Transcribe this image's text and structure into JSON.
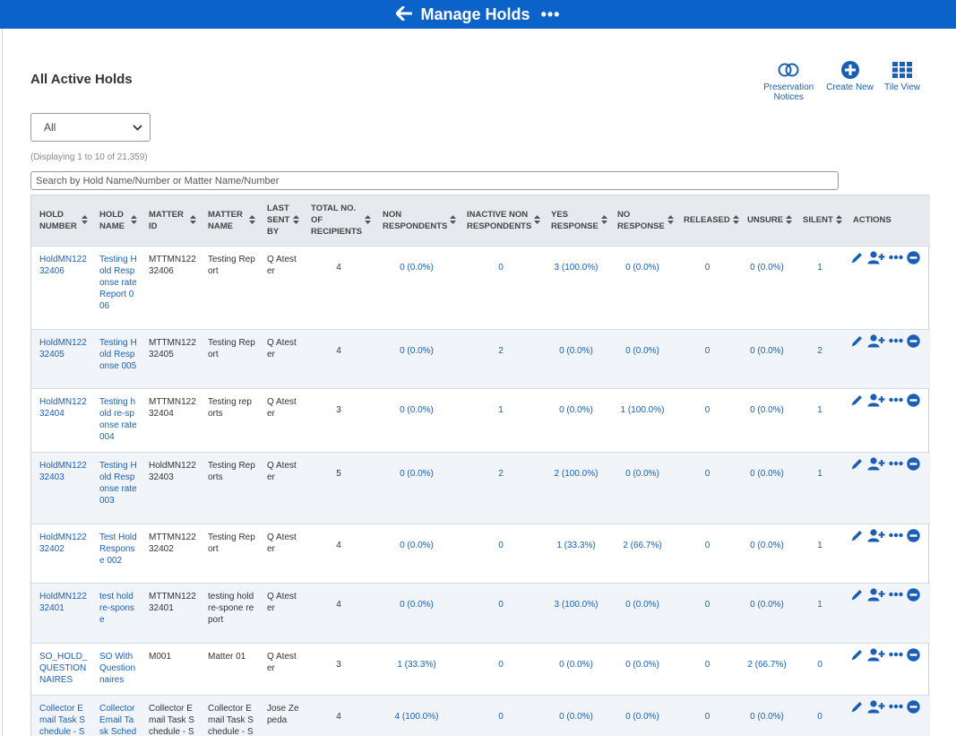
{
  "header": {
    "title": "Manage Holds",
    "back_label": "🡐",
    "more_label": "•••"
  },
  "page": {
    "title": "All Active Holds",
    "filter_value": "All",
    "displaying": "(Displaying 1 to 10 of 21,359)",
    "search_placeholder": "Search by Hold Name/Number or Matter Name/Number"
  },
  "top_actions": {
    "preservation_label": "Preservation Notices",
    "create_label": "Create New",
    "tile_label": "Tile View"
  },
  "columns": [
    "HOLD NUMBER",
    "HOLD NAME",
    "MATTER ID",
    "MATTER NAME",
    "LAST SENT BY",
    "TOTAL NO. OF RECIPIENTS",
    "NON RESPONDENTS",
    "INACTIVE NON RESPONDENTS",
    "YES RESPONSE",
    "NO RESPONSE",
    "RELEASED",
    "UNSURE",
    "SILENT",
    "ACTIONS"
  ],
  "rows": [
    {
      "hold_number": "HoldMN12232406",
      "hold_name": "Testing Hold Response rate Report 006",
      "matter_id": "MTTMN12232406",
      "matter_name": "Testing Report",
      "last_sent_by": "Q Atester",
      "total": "4",
      "non_resp": "0 (0.0%)",
      "inactive": "0",
      "yes": "3 (100.0%)",
      "no": "0 (0.0%)",
      "released": "0",
      "unsure": "0 (0.0%)",
      "silent": "1"
    },
    {
      "hold_number": "HoldMN12232405",
      "hold_name": "Testing Hold Response 005",
      "matter_id": "MTTMN12232405",
      "matter_name": "Testing Report",
      "last_sent_by": "Q Atester",
      "total": "4",
      "non_resp": "0 (0.0%)",
      "inactive": "2",
      "yes": "0 (0.0%)",
      "no": "0 (0.0%)",
      "released": "0",
      "unsure": "0 (0.0%)",
      "silent": "2"
    },
    {
      "hold_number": "HoldMN12232404",
      "hold_name": "Testing hold re-sponse rate 004",
      "matter_id": "MTTMN12232404",
      "matter_name": "Testing reports",
      "last_sent_by": "Q Atester",
      "total": "3",
      "non_resp": "0 (0.0%)",
      "inactive": "1",
      "yes": "0 (0.0%)",
      "no": "1 (100.0%)",
      "released": "0",
      "unsure": "0 (0.0%)",
      "silent": "1"
    },
    {
      "hold_number": "HoldMN12232403",
      "hold_name": "Testing Hold Response rate 003",
      "matter_id": "HoldMN12232403",
      "matter_name": "Testing Reports",
      "last_sent_by": "Q Atester",
      "total": "5",
      "non_resp": "0 (0.0%)",
      "inactive": "2",
      "yes": "2 (100.0%)",
      "no": "0 (0.0%)",
      "released": "0",
      "unsure": "0 (0.0%)",
      "silent": "1"
    },
    {
      "hold_number": "HoldMN12232402",
      "hold_name": "Test Hold Response 002",
      "matter_id": "MTTMN12232402",
      "matter_name": "Testing Report",
      "last_sent_by": "Q Atester",
      "total": "4",
      "non_resp": "0 (0.0%)",
      "inactive": "0",
      "yes": "1 (33.3%)",
      "no": "2 (66.7%)",
      "released": "0",
      "unsure": "0 (0.0%)",
      "silent": "1"
    },
    {
      "hold_number": "HoldMN12232401",
      "hold_name": "test hold re-sponse",
      "matter_id": "MTTMN12232401",
      "matter_name": "testing hold re-spone report",
      "last_sent_by": "Q Atester",
      "total": "4",
      "non_resp": "0 (0.0%)",
      "inactive": "0",
      "yes": "3 (100.0%)",
      "no": "0 (0.0%)",
      "released": "0",
      "unsure": "0 (0.0%)",
      "silent": "1"
    },
    {
      "hold_number": "SO_HOLD_QUESTIONNAIRES",
      "hold_name": "SO With Questionnaires",
      "matter_id": "M001",
      "matter_name": "Matter 01",
      "last_sent_by": "Q Atester",
      "total": "3",
      "non_resp": "1 (33.3%)",
      "inactive": "0",
      "yes": "0 (0.0%)",
      "no": "0 (0.0%)",
      "released": "0",
      "unsure": "2 (66.7%)",
      "silent": "0"
    },
    {
      "hold_number": "Collector Email Task Schedule - Smoke",
      "hold_name": "Collector Email Task Schedul",
      "matter_id": "Collector Email Task Schedule - Smoke",
      "matter_name": "Collector Email Task Schedule - Smoke",
      "last_sent_by": "Jose Zepeda",
      "total": "4",
      "non_resp": "4 (100.0%)",
      "inactive": "0",
      "yes": "0 (0.0%)",
      "no": "0 (0.0%)",
      "released": "0",
      "unsure": "0 (0.0%)",
      "silent": "0"
    }
  ]
}
